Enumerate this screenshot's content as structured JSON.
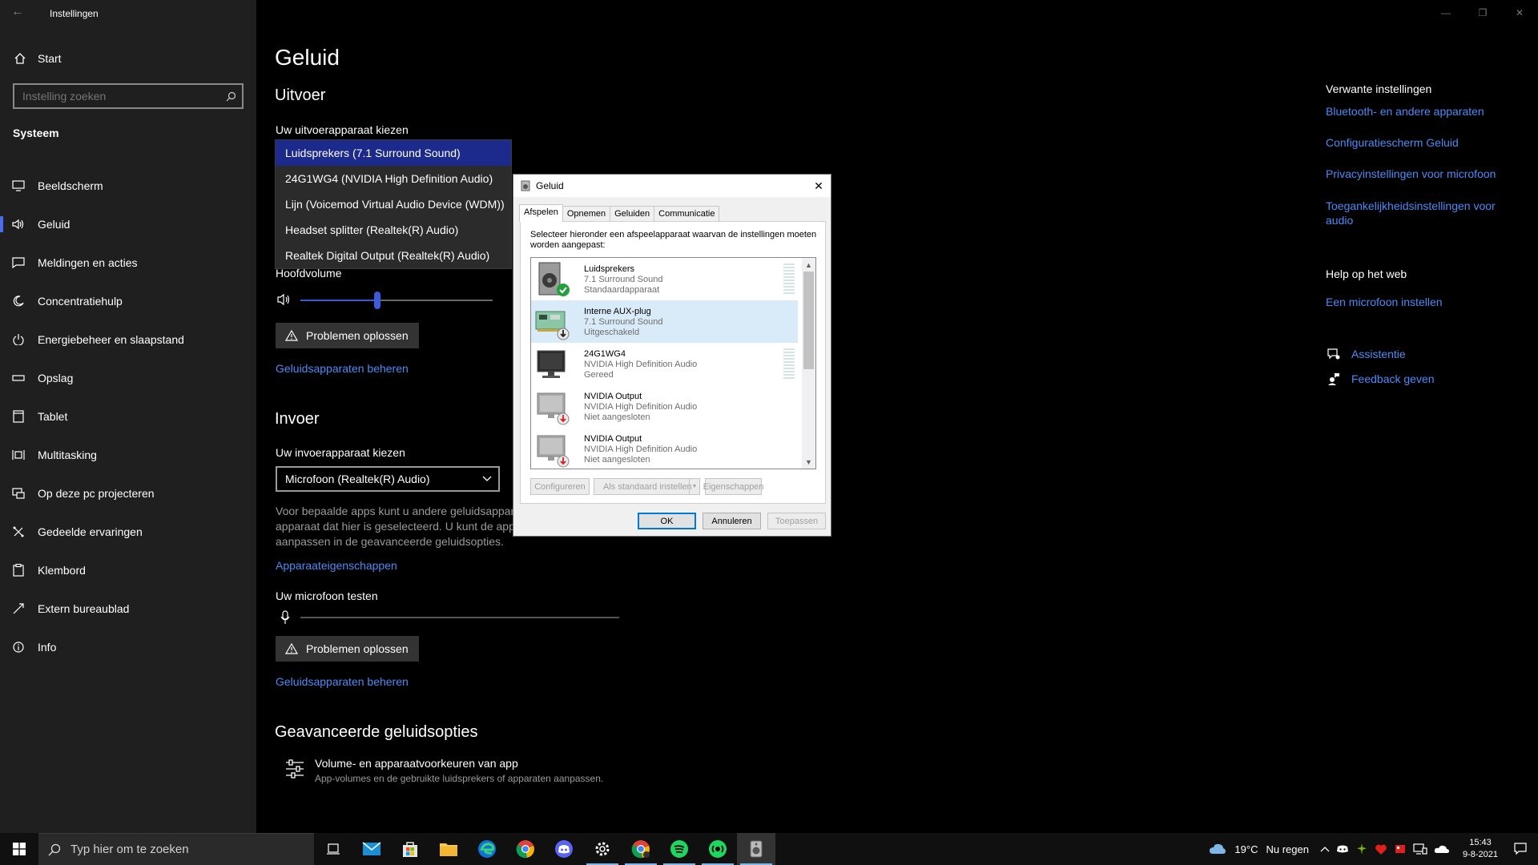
{
  "app": {
    "title": "Instellingen"
  },
  "sidebar": {
    "home": "Start",
    "search_placeholder": "Instelling zoeken",
    "section": "Systeem",
    "items": [
      {
        "label": "Beeldscherm",
        "icon": "monitor-icon"
      },
      {
        "label": "Geluid",
        "icon": "speaker-icon",
        "active": true
      },
      {
        "label": "Meldingen en acties",
        "icon": "notification-icon"
      },
      {
        "label": "Concentratiehulp",
        "icon": "moon-icon"
      },
      {
        "label": "Energiebeheer en slaapstand",
        "icon": "power-icon"
      },
      {
        "label": "Opslag",
        "icon": "storage-icon"
      },
      {
        "label": "Tablet",
        "icon": "tablet-icon"
      },
      {
        "label": "Multitasking",
        "icon": "multitasking-icon"
      },
      {
        "label": "Op deze pc projecteren",
        "icon": "project-icon"
      },
      {
        "label": "Gedeelde ervaringen",
        "icon": "shared-icon"
      },
      {
        "label": "Klembord",
        "icon": "clipboard-icon"
      },
      {
        "label": "Extern bureaublad",
        "icon": "remote-icon"
      },
      {
        "label": "Info",
        "icon": "info-icon"
      }
    ]
  },
  "main": {
    "title": "Geluid",
    "output": {
      "heading": "Uitvoer",
      "choose_label": "Uw uitvoerapparaat kiezen",
      "options": [
        "Luidsprekers (7.1 Surround Sound)",
        "24G1WG4 (NVIDIA High Definition Audio)",
        "Lijn (Voicemod Virtual Audio Device (WDM))",
        "Headset splitter  (Realtek(R) Audio)",
        "Realtek Digital Output (Realtek(R) Audio)"
      ],
      "selected_index": 0,
      "hidden_label": "Hoofdvolume",
      "volume_fraction": 0.4,
      "troubleshoot": "Problemen oplossen",
      "manage_link": "Geluidsapparaten beheren"
    },
    "input": {
      "heading": "Invoer",
      "choose_label": "Uw invoerapparaat kiezen",
      "selected": "Microfoon (Realtek(R) Audio)",
      "description": "Voor bepaalde apps kunt u andere geluidsappar apparaat dat hier is geselecteerd. U kunt de app aanpassen in de geavanceerde geluidsopties.",
      "device_props_link": "Apparaateigenschappen",
      "test_label": "Uw microfoon testen",
      "troubleshoot": "Problemen oplossen",
      "manage_link": "Geluidsapparaten beheren"
    },
    "advanced": {
      "heading": "Geavanceerde geluidsopties",
      "row_title": "Volume- en apparaatvoorkeuren van app",
      "row_sub": "App-volumes en de gebruikte luidsprekers of apparaten aanpassen."
    }
  },
  "right": {
    "related_heading": "Verwante instellingen",
    "related_links": [
      "Bluetooth- en andere apparaten",
      "Configuratiescherm Geluid",
      "Privacyinstellingen voor microfoon",
      "Toegankelijkheidsinstellingen voor audio"
    ],
    "help_heading": "Help op het web",
    "help_link": "Een microfoon instellen",
    "assist": "Assistentie",
    "feedback": "Feedback geven"
  },
  "dialog": {
    "title": "Geluid",
    "tabs": [
      "Afspelen",
      "Opnemen",
      "Geluiden",
      "Communicatie"
    ],
    "description": "Selecteer hieronder een afspeelapparaat waarvan de instellingen moeten worden aangepast:",
    "devices": [
      {
        "name": "Luidsprekers",
        "type": "7.1 Surround Sound",
        "status": "Standaardapparaat",
        "badge": "default"
      },
      {
        "name": "Interne AUX-plug",
        "type": "7.1 Surround Sound",
        "status": "Uitgeschakeld",
        "badge": "disabled"
      },
      {
        "name": "24G1WG4",
        "type": "NVIDIA High Definition Audio",
        "status": "Gereed",
        "badge": "none"
      },
      {
        "name": "NVIDIA Output",
        "type": "NVIDIA High Definition Audio",
        "status": "Niet aangesloten",
        "badge": "unplugged"
      },
      {
        "name": "NVIDIA Output",
        "type": "NVIDIA High Definition Audio",
        "status": "Niet aangesloten",
        "badge": "unplugged"
      }
    ],
    "btn_configure": "Configureren",
    "btn_default": "Als standaard instellen",
    "btn_properties": "Eigenschappen",
    "btn_ok": "OK",
    "btn_cancel": "Annuleren",
    "btn_apply": "Toepassen"
  },
  "taskbar": {
    "search_placeholder": "Typ hier om te zoeken",
    "weather_temp": "19°C",
    "weather_text": "Nu regen",
    "time": "15:43",
    "date": "9-8-2021"
  }
}
